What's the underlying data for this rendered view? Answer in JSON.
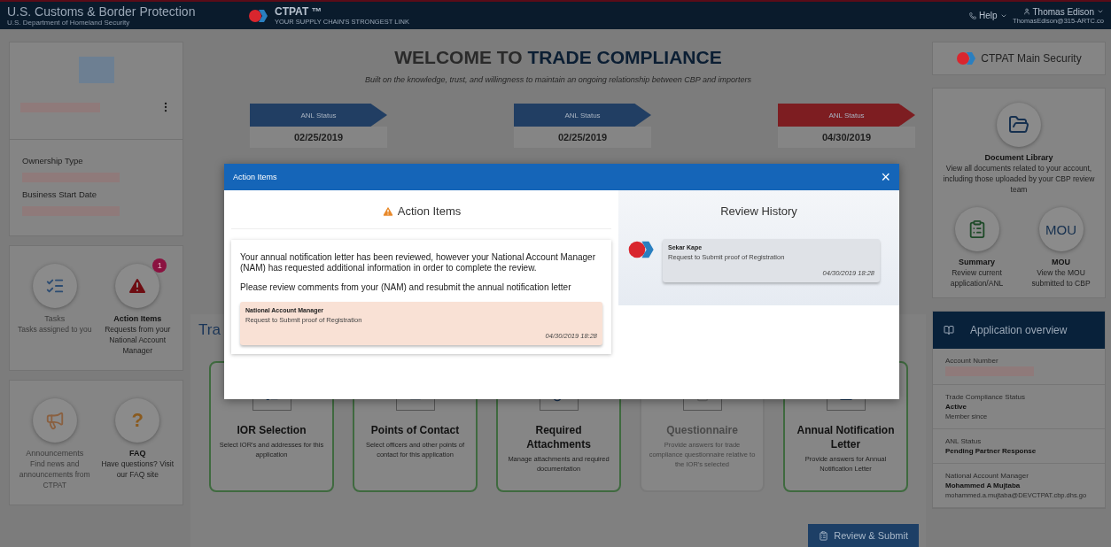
{
  "header": {
    "agency": "U.S. Customs & Border Protection",
    "department": "U.S. Department of Homeland Security",
    "program": "CTPAT ™",
    "tagline": "YOUR SUPPLY CHAIN'S STRONGEST LINK",
    "help": "Help",
    "user": "Thomas Edison",
    "email": "ThomasEdison@315-ARTC.co"
  },
  "company": {
    "fields": [
      {
        "label": "Ownership Type"
      },
      {
        "label": "Business Start Date"
      }
    ]
  },
  "tiles": [
    {
      "title": "Tasks",
      "description": "Tasks assigned to you",
      "disabled": true
    },
    {
      "title": "Action Items",
      "description": "Requests from your National Account Manager",
      "disabled": false,
      "badge": "1"
    },
    {
      "title": "Announcements",
      "description": "Find news and announcements from CTPAT",
      "disabled": true
    },
    {
      "title": "FAQ",
      "description": "Have questions? Visit our FAQ site",
      "disabled": false,
      "glyph": "?"
    }
  ],
  "welcome": {
    "title_lead": "WELCOME TO ",
    "title_emphasis": "TRADE COMPLIANCE",
    "subtitle": "Built on the knowledge, trust, and willingness to maintain an ongoing relationship between CBP and importers"
  },
  "statuses": [
    {
      "label": "ANL Status",
      "date": "02/25/2019",
      "color": "#213e63"
    },
    {
      "label": "ANL Status",
      "date": "02/25/2019",
      "color": "#213e63"
    },
    {
      "label": "ANL Status",
      "date": "04/30/2019",
      "color": "#7d1d21"
    }
  ],
  "section_title": "Tra",
  "cards": [
    {
      "title": "IOR Selection",
      "description": "Select IOR's and addresses for this application",
      "disabled": false
    },
    {
      "title": "Points of Contact",
      "description": "Select officers and other points of contact for this application",
      "disabled": false
    },
    {
      "title": "Required Attachments",
      "description": "Manage attachments and required documentation",
      "disabled": false
    },
    {
      "title": "Questionnaire",
      "description": "Provide answers for trade compliance questionnaire relative to the IOR's selected",
      "disabled": true
    },
    {
      "title": "Annual Notification Letter",
      "description": "Provide answers for Annual Notification Letter",
      "disabled": false
    }
  ],
  "submit_button": "Review & Submit",
  "right": {
    "main_security": "CTPAT Main Security",
    "library": {
      "title": "Document Library",
      "description": "View all documents related to your account, including those uploaded by your CBP review team"
    },
    "shortcuts": [
      {
        "kind": "icon",
        "title": "Summary",
        "description": "Review current application/ANL"
      },
      {
        "kind": "text",
        "glyph": "MOU",
        "title": "MOU",
        "description": "View the MOU submitted to CBP"
      }
    ],
    "overview": {
      "title": "Application overview",
      "rows": [
        {
          "label": "Account Number"
        },
        {
          "label": "Trade Compliance Status",
          "value": "Active",
          "note": "Member since"
        },
        {
          "label": "ANL Status",
          "value": "Pending Partner Response"
        },
        {
          "label": "National Account Manager",
          "value": "Mohammed A Mujtaba",
          "note": "mohammed.a.mujtaba@DEVCTPAT.cbp.dhs.go"
        }
      ]
    }
  },
  "modal": {
    "title": "Action Items",
    "close": "×",
    "heading": "Action Items",
    "messages": [
      "Your annual notification letter has been reviewed, however your National Account Manager (NAM) has requested additional information in order to complete the review.",
      "Please review comments from your (NAM) and resubmit the annual notification letter"
    ],
    "comment": {
      "author": "National Account Manager",
      "text": "Request to Submit proof of Registration",
      "time": "04/30/2019 18:28"
    },
    "history_title": "Review History",
    "history": [
      {
        "author": "Sekar Kape",
        "text": "Request to Submit proof of Registration",
        "time": "04/30/2019 18:28"
      }
    ]
  }
}
